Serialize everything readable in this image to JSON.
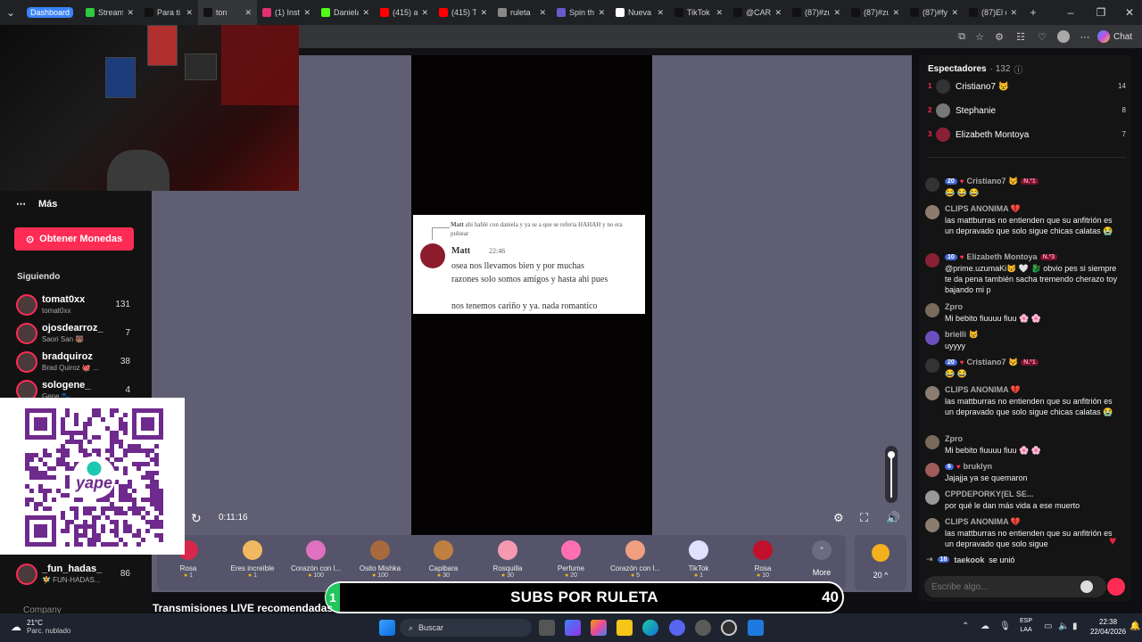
{
  "browser": {
    "tabs": [
      {
        "label": "Dashboard",
        "color": "#3b82f6"
      },
      {
        "label": "Stream",
        "color": "#2ecc40"
      },
      {
        "label": "Para ti",
        "color": "#111111"
      },
      {
        "label": "ton",
        "color": "#111111"
      },
      {
        "label": "(1) Insta",
        "color": "#e1306c"
      },
      {
        "label": "Daniela",
        "color": "#53fc18"
      },
      {
        "label": "(415) au",
        "color": "#ff0000"
      },
      {
        "label": "(415) TI",
        "color": "#ff0000"
      },
      {
        "label": "ruleta",
        "color": "#888888"
      },
      {
        "label": "Spin the",
        "color": "#6a5acd"
      },
      {
        "label": "Nueva p",
        "color": "#ffffff"
      },
      {
        "label": "TikTok",
        "color": "#111111"
      },
      {
        "label": "@CARL",
        "color": "#111111"
      },
      {
        "label": "(87)#zu",
        "color": "#111111"
      },
      {
        "label": "(87)#zu",
        "color": "#111111"
      },
      {
        "label": "(87)#fy",
        "color": "#111111"
      },
      {
        "label": "(87)El d",
        "color": "#111111"
      }
    ],
    "chat_button": "Chat"
  },
  "sidebar": {
    "more_label": "Más",
    "coins_button": "Obtener Monedas",
    "following_title": "Siguiendo",
    "following": [
      {
        "name": "tomat0xx",
        "sub": "tomat0xx",
        "count": "131"
      },
      {
        "name": "ojosdearroz_",
        "sub": "Saori San 🐻",
        "count": "7"
      },
      {
        "name": "bradquiroz",
        "sub": "Brad Quiroz 🐙 ...",
        "count": "38"
      },
      {
        "name": "sologene_",
        "sub": "Gene 🐾 ...",
        "count": "4"
      },
      {
        "name": "_fun_hadas_",
        "sub": "🧚 FUN-HADAS...",
        "count": "86"
      }
    ],
    "company": "Company"
  },
  "stream": {
    "timer": "0:11:16",
    "tweet": {
      "reply_author": "Matt",
      "reply_text": "ahi hablé con daniela y ya se a que se refería HAHAH y no era pulsear",
      "author": "Matt",
      "time": "22:46",
      "body_line1": "osea nos llevamos bien y por muchas",
      "body_line2": "razones solo somos amigos y hasta ahi pues",
      "body_line3": "nos tenemos cariño y ya. nada romantico"
    },
    "gifts": [
      {
        "name": "Rosa",
        "price": "1",
        "color": "#d9264c"
      },
      {
        "name": "Eres increíble",
        "price": "1",
        "color": "#f0b860"
      },
      {
        "name": "Corazón con l...",
        "price": "100",
        "color": "#e070c0"
      },
      {
        "name": "Osito Mishka",
        "price": "100",
        "color": "#a86a3c"
      },
      {
        "name": "Capibara",
        "price": "30",
        "color": "#c08040"
      },
      {
        "name": "Rosquilla",
        "price": "30",
        "color": "#f59ab0"
      },
      {
        "name": "Perfume",
        "price": "20",
        "color": "#ff70b0"
      },
      {
        "name": "Corazón con l...",
        "price": "5",
        "color": "#f0a080"
      },
      {
        "name": "TikTok",
        "price": "1",
        "color": "#e0e0ff"
      },
      {
        "name": "Rosa",
        "price": "10",
        "color": "#c0102c"
      }
    ],
    "more_label": "More",
    "coin_count": "20 ^"
  },
  "subs_banner": {
    "lead": "1",
    "title": "SUBS POR RULETA",
    "number": "40"
  },
  "recommended_title": "Transmisiones LIVE recomendadas",
  "qr": {
    "brand": "yape",
    "color": "#6e2a8c"
  },
  "chat": {
    "viewers_title": "Espectadores",
    "viewers_count": "· 132",
    "top": [
      {
        "rank": "1",
        "name": "Cristiano7 😾",
        "score": "14"
      },
      {
        "rank": "2",
        "name": "Stephanie",
        "score": "8"
      },
      {
        "rank": "3",
        "name": "Elizabeth Montoya",
        "score": "7"
      }
    ],
    "messages": [
      {
        "user": "Cristiano7 😾",
        "level": "20",
        "badge": "N.º1",
        "text": "😂 😂 😂"
      },
      {
        "user": "CLIPS ANONIMA 💔",
        "level": "",
        "badge": "",
        "text": "las mattburras no entienden que su anfitrión es un depravado que solo sigue chicas calatas 😭"
      },
      {
        "user": "Elizabeth Montoya",
        "level": "10",
        "badge": "N.º3",
        "text": "@prime.uzumaKi😾 🤍 🐉 obvio pes si siempre te da pena también sacha tremendo cherazo toy bajando mi p"
      },
      {
        "user": "Zpro",
        "level": "",
        "badge": "",
        "text": "Mi bebito fiuuuu fiuu 🌸 🌸"
      },
      {
        "user": "brielli 😾",
        "level": "",
        "badge": "",
        "text": "uyyyy"
      },
      {
        "user": "Cristiano7 😾",
        "level": "20",
        "badge": "N.º1",
        "text": "😂 😂"
      },
      {
        "user": "CLIPS ANONIMA 💔",
        "level": "",
        "badge": "",
        "text": "las mattburras no entienden que su anfitrión es un depravado que solo sigue chicas calatas 😭"
      },
      {
        "user": "Zpro",
        "level": "",
        "badge": "",
        "text": "Mi bebito fiuuuu fiuu 🌸 🌸"
      },
      {
        "user": "bruklyn",
        "level": "6",
        "badge": "",
        "text": "Jajajja ya se quemaron"
      },
      {
        "user": "CPPDEPORKY(EL SE...",
        "level": "",
        "badge": "",
        "text": "por qué le dan más vida a ese muerto"
      },
      {
        "user": "CLIPS ANONIMA 💔",
        "level": "",
        "badge": "",
        "text": "las mattburras no entienden que su anfitrión es un depravado que solo sigue"
      }
    ],
    "join_level": "18",
    "join_user": "taekook",
    "join_text": "se unió",
    "input_placeholder": "Escribe algo..."
  },
  "taskbar": {
    "temp": "21°C",
    "weather": "Parc. nublado",
    "search": "Buscar",
    "lang1": "ESP",
    "lang2": "LAA",
    "time": "22:38",
    "date": "22/04/2026"
  }
}
